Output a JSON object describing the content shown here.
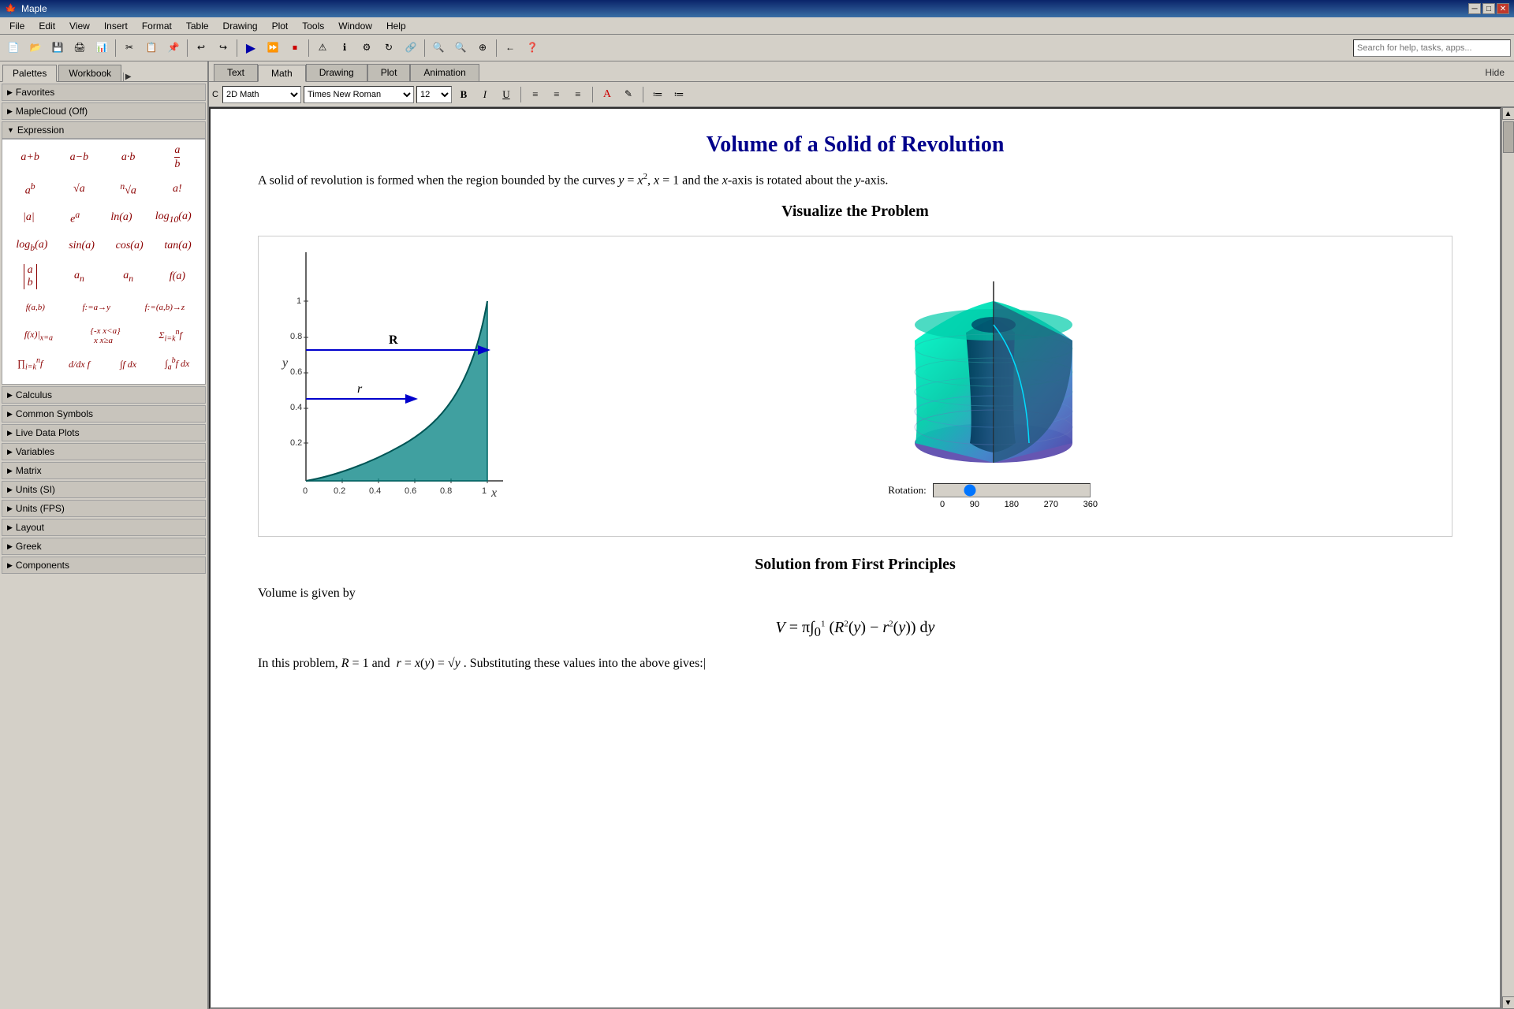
{
  "app": {
    "title": "Maple",
    "icon": "🍁"
  },
  "title_bar": {
    "title": "Maple",
    "minimize": "─",
    "maximize": "□",
    "close": "✕"
  },
  "menu": {
    "items": [
      "File",
      "Edit",
      "View",
      "Insert",
      "Format",
      "Table",
      "Drawing",
      "Plot",
      "Tools",
      "Window",
      "Help"
    ]
  },
  "toolbar": {
    "search_placeholder": "Search for help, tasks, apps..."
  },
  "left_panel": {
    "tabs": [
      "Palettes",
      "Workbook"
    ],
    "active_tab": "Palettes"
  },
  "format_tabs": {
    "tabs": [
      "Text",
      "Math",
      "Drawing",
      "Plot",
      "Animation"
    ],
    "active_tab": "Math",
    "hide_label": "Hide"
  },
  "text_format_bar": {
    "mode_options": [
      "2D Math"
    ],
    "mode_selected": "2D Math",
    "font_options": [
      "Times New Roman"
    ],
    "font_selected": "Times New Roman",
    "size_options": [
      "12"
    ],
    "size_selected": "12",
    "bold": "B",
    "italic": "I",
    "underline": "U"
  },
  "palettes": {
    "favorites": "Favorites",
    "maplecloudoff": "MapleCloud (Off)",
    "expression": "Expression",
    "calculus": "Calculus",
    "common_symbols": "Common Symbols",
    "live_data_plots": "Live Data Plots",
    "variables": "Variables",
    "matrix": "Matrix",
    "units_si": "Units (SI)",
    "units_fps": "Units (FPS)",
    "layout": "Layout",
    "greek": "Greek",
    "components": "Components"
  },
  "document": {
    "title": "Volume of a Solid of Revolution",
    "intro": "A solid of revolution is formed when the region bounded by the curves",
    "intro_math": "y = x², x = 1",
    "intro_cont": "and the",
    "intro_axis": "x",
    "intro_end": "-axis",
    "intro2": "is rotated about the",
    "intro2_axis": "y",
    "intro2_end": "-axis.",
    "viz_title": "Visualize the Problem",
    "solution_title": "Solution from First Principles",
    "solution_intro": "Volume is given by",
    "formula": "V = π∫₀¹ (R²(y) − r²(y)) dy",
    "last_line": "In this problem, R = 1 and r = x(y) = √y . Substituting these values into the above gives:"
  },
  "graph": {
    "x_label": "x",
    "y_label": "y",
    "x_ticks": [
      "0",
      "0.2",
      "0.4",
      "0.6",
      "0.8",
      "1"
    ],
    "y_ticks": [
      "0.2",
      "0.4",
      "0.6",
      "0.8",
      "1"
    ],
    "R_label": "R",
    "r_label": "r"
  },
  "rotation": {
    "label": "Rotation:",
    "ticks": [
      "0",
      "90",
      "180",
      "270",
      "360"
    ],
    "value": 75
  }
}
